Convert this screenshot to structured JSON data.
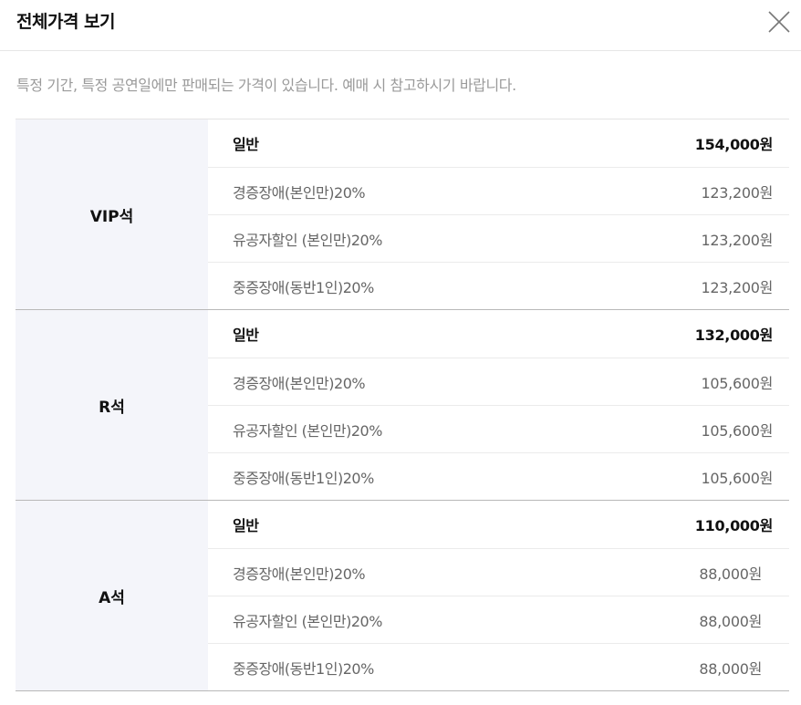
{
  "title": "전체가격 보기",
  "notice": "특정 기간, 특정 공연일에만 판매되는 가격이 있습니다. 예매 시 참고하시기 바랍니다.",
  "groups": [
    {
      "grade": "VIP석",
      "rows": [
        {
          "name": "일반",
          "price": "154,000원"
        },
        {
          "name": "경증장애(본인만)20%",
          "price": "123,200원"
        },
        {
          "name": "유공자할인 (본인만)20%",
          "price": "123,200원"
        },
        {
          "name": "중증장애(동반1인)20%",
          "price": "123,200원"
        }
      ]
    },
    {
      "grade": "R석",
      "rows": [
        {
          "name": "일반",
          "price": "132,000원"
        },
        {
          "name": "경증장애(본인만)20%",
          "price": "105,600원"
        },
        {
          "name": "유공자할인 (본인만)20%",
          "price": "105,600원"
        },
        {
          "name": "중증장애(동반1인)20%",
          "price": "105,600원"
        }
      ]
    },
    {
      "grade": "A석",
      "rows": [
        {
          "name": "일반",
          "price": "110,000원"
        },
        {
          "name": "경증장애(본인만)20%",
          "price": "88,000원"
        },
        {
          "name": "유공자할인 (본인만)20%",
          "price": "88,000원"
        },
        {
          "name": "중증장애(동반1인)20%",
          "price": "88,000원"
        }
      ]
    }
  ]
}
